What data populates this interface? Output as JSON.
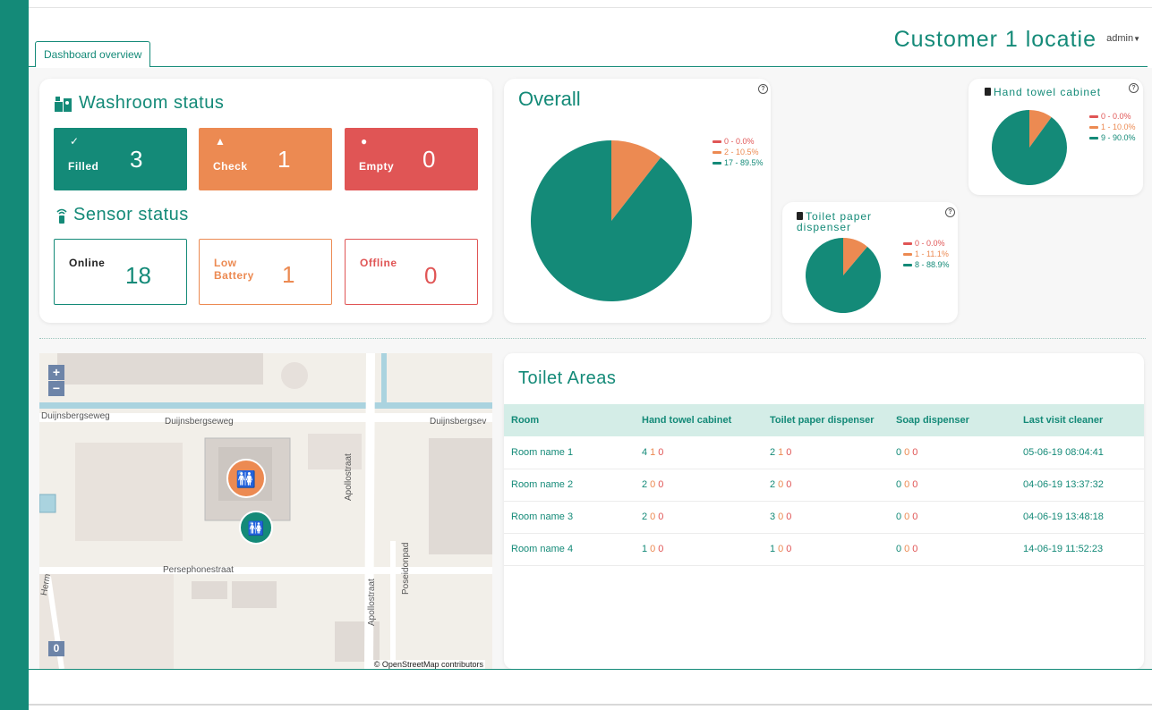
{
  "header": {
    "tab_label": "Dashboard overview",
    "customer_title": "Customer 1 locatie",
    "user_menu": "admin"
  },
  "colors": {
    "brand": "#148a78",
    "empty": "#e05555",
    "check": "#ec8a52",
    "tab_header_bg": "#d4ede7"
  },
  "washroom": {
    "title": "Washroom status",
    "icon": "washroom-icon",
    "filled": {
      "label": "Filled",
      "value": "3",
      "icon": "check-icon"
    },
    "check": {
      "label": "Check",
      "value": "1",
      "icon": "warning-icon"
    },
    "empty": {
      "label": "Empty",
      "value": "0",
      "icon": "alert-icon"
    }
  },
  "sensor": {
    "title": "Sensor status",
    "icon": "wifi-sensor-icon",
    "online": {
      "label": "Online",
      "value": "18"
    },
    "low_battery": {
      "label_line1": "Low",
      "label_line2": "Battery",
      "value": "1"
    },
    "offline": {
      "label": "Offline",
      "value": "0"
    }
  },
  "chart_data": [
    {
      "type": "pie",
      "title": "Overall",
      "categories": [
        "0 - 0.0%",
        "2 - 10.5%",
        "17 - 89.5%"
      ],
      "values": [
        0,
        2,
        17
      ],
      "colors": [
        "#e05555",
        "#ec8a52",
        "#148a78"
      ],
      "legend": "right"
    },
    {
      "type": "pie",
      "title": "Toilet paper dispenser",
      "title_line1": "Toilet paper",
      "title_line2": "dispenser",
      "categories": [
        "0 - 0.0%",
        "1 - 11.1%",
        "8 - 88.9%"
      ],
      "values": [
        0,
        1,
        8
      ],
      "colors": [
        "#e05555",
        "#ec8a52",
        "#148a78"
      ],
      "legend": "right"
    },
    {
      "type": "pie",
      "title": "Hand towel cabinet",
      "categories": [
        "0 - 0.0%",
        "1 - 10.0%",
        "9 - 90.0%"
      ],
      "values": [
        0,
        1,
        9
      ],
      "colors": [
        "#e05555",
        "#ec8a52",
        "#148a78"
      ],
      "legend": "right"
    }
  ],
  "map": {
    "zoom_in": "+",
    "zoom_out": "−",
    "attribution": "© OpenStreetMap contributors",
    "counter": "0",
    "streets": [
      "Duijnsbergseweg",
      "Duijnsbergseweg",
      "Duijnsbergsev",
      "Apollostraat",
      "Persephonestraat",
      "Poseidonpad",
      "Apollostraat",
      "Herm"
    ],
    "markers": [
      "toilet-marker-orange",
      "toilet-marker-teal"
    ]
  },
  "toilet_areas": {
    "title": "Toilet Areas",
    "columns": [
      "Room",
      "Hand towel cabinet",
      "Toilet paper dispenser",
      "Soap dispenser",
      "Last visit cleaner"
    ],
    "rows": [
      {
        "room": "Room name 1",
        "towel": [
          "4",
          "1",
          "0"
        ],
        "paper": [
          "2",
          "1",
          "0"
        ],
        "soap": [
          "0",
          "0",
          "0"
        ],
        "last": "05-06-19 08:04:41"
      },
      {
        "room": "Room name 2",
        "towel": [
          "2",
          "0",
          "0"
        ],
        "paper": [
          "2",
          "0",
          "0"
        ],
        "soap": [
          "0",
          "0",
          "0"
        ],
        "last": "04-06-19 13:37:32"
      },
      {
        "room": "Room name 3",
        "towel": [
          "2",
          "0",
          "0"
        ],
        "paper": [
          "3",
          "0",
          "0"
        ],
        "soap": [
          "0",
          "0",
          "0"
        ],
        "last": "04-06-19 13:48:18"
      },
      {
        "room": "Room name 4",
        "towel": [
          "1",
          "0",
          "0"
        ],
        "paper": [
          "1",
          "0",
          "0"
        ],
        "soap": [
          "0",
          "0",
          "0"
        ],
        "last": "14-06-19 11:52:23"
      }
    ]
  }
}
